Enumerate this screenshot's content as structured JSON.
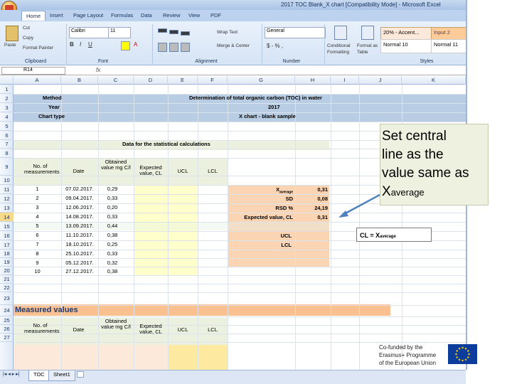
{
  "window": {
    "title": "2017 TOC Blank_X chart  [Compatibility Mode] - Microsoft Excel"
  },
  "ribbon": {
    "tabs": [
      "Home",
      "Insert",
      "Page Layout",
      "Formulas",
      "Data",
      "Review",
      "View",
      "PDF"
    ],
    "clipboard": {
      "paste": "Paste",
      "cut": "Cut",
      "copy": "Copy",
      "format_painter": "Format Painter",
      "label": "Clipboard"
    },
    "font": {
      "name": "Calibri",
      "size": "11",
      "label": "Font"
    },
    "alignment": {
      "wrap_text": "Wrap Text",
      "merge_center": "Merge & Center",
      "label": "Alignment"
    },
    "number": {
      "format": "General",
      "label": "Number"
    },
    "styles": {
      "conditional_formatting": "Conditional Formatting",
      "format_as_table": "Format as Table",
      "cells": [
        "20% - Accent...",
        "Input 2",
        "Normal 10",
        "Normal 11"
      ],
      "label": "Styles"
    }
  },
  "formula_bar": {
    "name_box": "R14",
    "fx": "fx"
  },
  "columns": [
    "A",
    "B",
    "C",
    "D",
    "E",
    "F",
    "G",
    "H",
    "I",
    "J",
    "K"
  ],
  "rows": [
    "1",
    "2",
    "3",
    "4",
    "5",
    "6",
    "7",
    "8",
    "9",
    "10",
    "11",
    "12",
    "13",
    "14",
    "15",
    "16",
    "17",
    "18",
    "19",
    "20",
    "21",
    "22",
    "23",
    "24",
    "25",
    "26",
    "27"
  ],
  "header_block": {
    "method_label": "Method",
    "method_value": "Determination of total organic carbon (TOC) in water",
    "year_label": "Year",
    "year_value": "2017",
    "chart_type_label": "Chart type",
    "chart_type_value": "X chart - blank sample"
  },
  "stats_section": {
    "title": "Data for the statistical calculations"
  },
  "table_headers": [
    "No. of measurements",
    "Date",
    "Obtained value mg C/l",
    "Expected value, CL",
    "UCL",
    "LCL"
  ],
  "measurements": [
    {
      "no": "1",
      "date": "07.02.2017.",
      "value": "0,29"
    },
    {
      "no": "2",
      "date": "09.04.2017.",
      "value": "0,33"
    },
    {
      "no": "3",
      "date": "12.06.2017.",
      "value": "0,20"
    },
    {
      "no": "4",
      "date": "14.08.2017.",
      "value": "0,33"
    },
    {
      "no": "5",
      "date": "13.09.2017.",
      "value": "0,44"
    },
    {
      "no": "6",
      "date": "11.10.2017.",
      "value": "0,38"
    },
    {
      "no": "7",
      "date": "18.10.2017.",
      "value": "0,25"
    },
    {
      "no": "8",
      "date": "25.10.2017.",
      "value": "0,33"
    },
    {
      "no": "9",
      "date": "05.12.2017.",
      "value": "0,32"
    },
    {
      "no": "10",
      "date": "27.12.2017.",
      "value": "0,38"
    }
  ],
  "stats": [
    {
      "label_main": "X",
      "label_sub": "average",
      "value": "0,31"
    },
    {
      "label_main": "SD",
      "label_sub": "",
      "value": "0,08"
    },
    {
      "label_main": "RSD %",
      "label_sub": "",
      "value": "24,19"
    },
    {
      "label_main": "Expected value, CL",
      "label_sub": "",
      "value": "0,31"
    }
  ],
  "limits": [
    "UCL",
    "LCL"
  ],
  "measured_section": {
    "title": "Measured values"
  },
  "measured_headers": [
    "No. of measurements",
    "Date",
    "Obtained value mg C/l",
    "Expected value, CL",
    "UCL",
    "LCL"
  ],
  "sheet_tabs": [
    "TOC",
    "Sheet1"
  ],
  "callout": {
    "line1": "Set central",
    "line2": "line as the",
    "line3": "value same as",
    "x": "X",
    "sub": "average"
  },
  "cl_box": {
    "text": "CL = X",
    "sub": "average"
  },
  "footer": {
    "line1": "Co-funded by the",
    "line2": "Erasmus+ Programme",
    "line3": "of the European Union"
  },
  "colors": {
    "header_blue": "#b8cce4",
    "orange": "#fbd4b4",
    "green": "#ebf1de",
    "yellow": "#ffffcc",
    "section_orange": "#fac090"
  }
}
